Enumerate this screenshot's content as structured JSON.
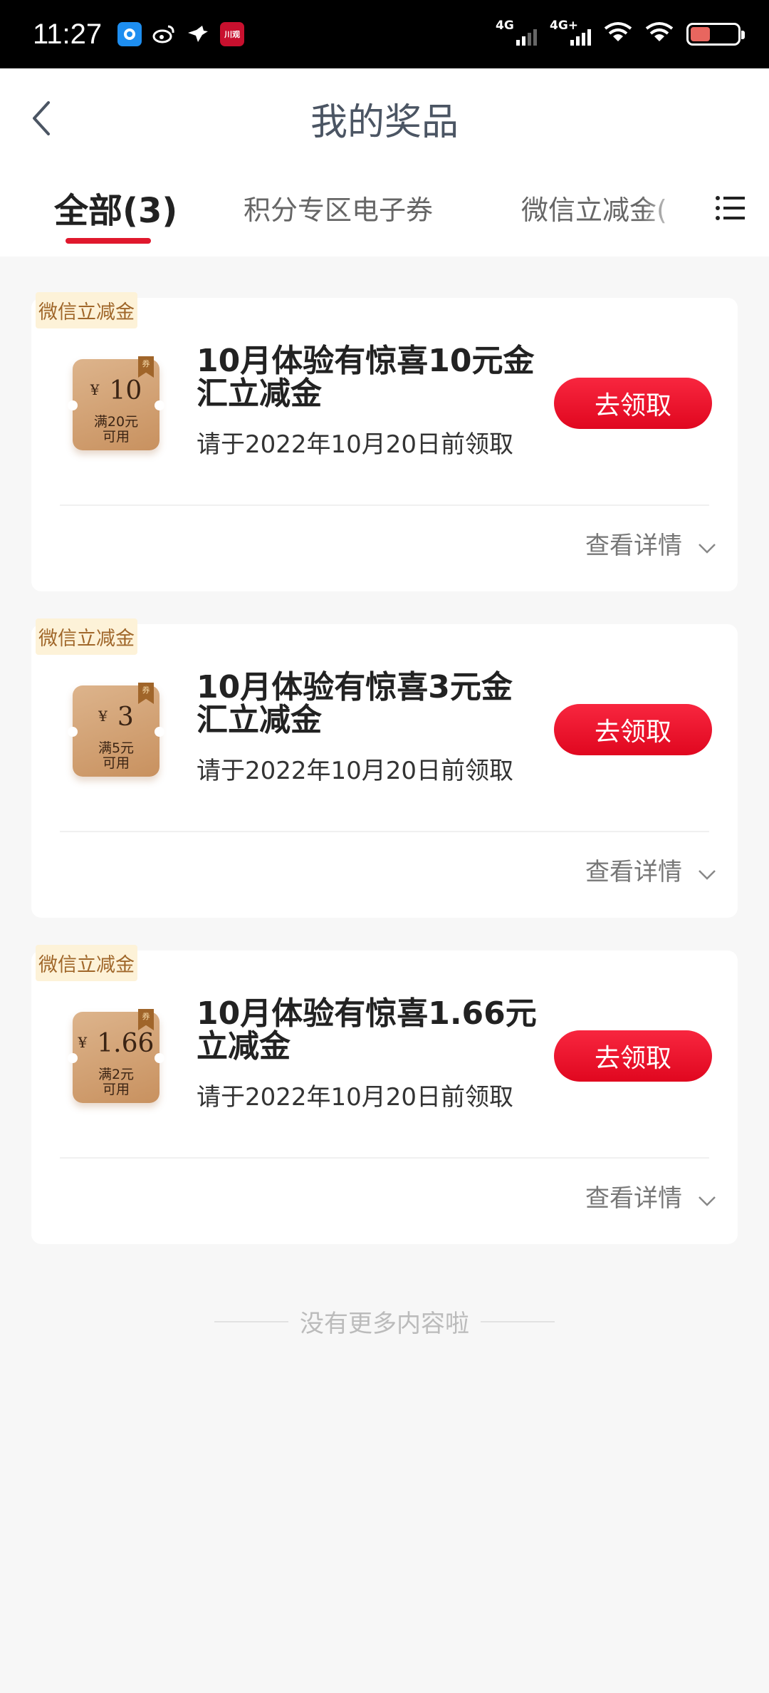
{
  "status_bar": {
    "time": "11:27",
    "network_1": "4G",
    "network_2": "4G+",
    "app_icon_1": "川观"
  },
  "header": {
    "title": "我的奖品"
  },
  "tabs": [
    {
      "label": "全部(3)",
      "active": true
    },
    {
      "label": "积分专区电子券",
      "active": false
    },
    {
      "label": "微信立减金(",
      "active": false
    }
  ],
  "prizes": [
    {
      "tag": "微信立减金",
      "currency": "¥",
      "amount": "10",
      "condition_line1": "满20元",
      "condition_line2": "可用",
      "ribbon": "券",
      "title": "10月体验有惊喜10元金汇立减金",
      "deadline": "请于2022年10月20日前领取",
      "claim_label": "去领取",
      "details_label": "查看详情"
    },
    {
      "tag": "微信立减金",
      "currency": "¥",
      "amount": "3",
      "condition_line1": "满5元",
      "condition_line2": "可用",
      "ribbon": "券",
      "title": "10月体验有惊喜3元金汇立减金",
      "deadline": "请于2022年10月20日前领取",
      "claim_label": "去领取",
      "details_label": "查看详情"
    },
    {
      "tag": "微信立减金",
      "currency": "¥",
      "amount": "1.66",
      "condition_line1": "满2元",
      "condition_line2": "可用",
      "ribbon": "券",
      "title": "10月体验有惊喜1.66元立减金",
      "deadline": "请于2022年10月20日前领取",
      "claim_label": "去领取",
      "details_label": "查看详情"
    }
  ],
  "footer": {
    "no_more": "没有更多内容啦"
  },
  "colors": {
    "accent": "#e0182d",
    "coupon": "#c8915f",
    "tag_bg": "#fdf2d8",
    "tag_text": "#a0672a"
  }
}
